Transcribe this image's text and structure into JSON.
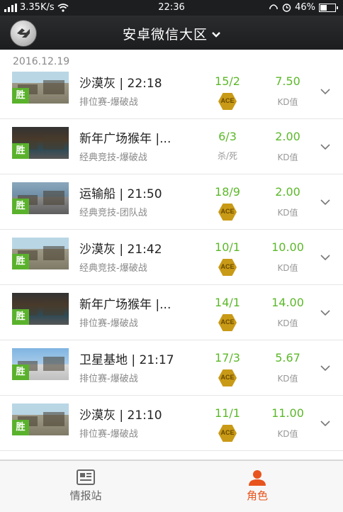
{
  "status_bar": {
    "signal": "ᵢₗ",
    "speed": "3.35K/s",
    "time": "22:36",
    "battery": "46%",
    "battery_level": 0.46
  },
  "header": {
    "title": "安卓微信大区"
  },
  "date": "2016.12.19",
  "matches": [
    {
      "map": "沙漠灰 | 22:18",
      "mode": "排位赛-爆破战",
      "score": "15/2",
      "badge": "ACE",
      "sub_text": "",
      "kd": "7.50",
      "kd_label": "KD值",
      "result": "胜",
      "thumb": "desert"
    },
    {
      "map": "新年广场猴年 |...",
      "mode": "经典竞技-爆破战",
      "score": "6/3",
      "badge": "",
      "sub_text": "杀/死",
      "kd": "2.00",
      "kd_label": "KD值",
      "result": "胜",
      "thumb": "night"
    },
    {
      "map": "运输船 | 21:50",
      "mode": "经典竞技-团队战",
      "score": "18/9",
      "badge": "ACE",
      "sub_text": "",
      "kd": "2.00",
      "kd_label": "KD值",
      "result": "胜",
      "thumb": "sea"
    },
    {
      "map": "沙漠灰 | 21:42",
      "mode": "经典竞技-爆破战",
      "score": "10/1",
      "badge": "ACE",
      "sub_text": "",
      "kd": "10.00",
      "kd_label": "KD值",
      "result": "胜",
      "thumb": "desert"
    },
    {
      "map": "新年广场猴年 |...",
      "mode": "排位赛-爆破战",
      "score": "14/1",
      "badge": "ACE",
      "sub_text": "",
      "kd": "14.00",
      "kd_label": "KD值",
      "result": "胜",
      "thumb": "night"
    },
    {
      "map": "卫星基地 | 21:17",
      "mode": "排位赛-爆破战",
      "score": "17/3",
      "badge": "ACE",
      "sub_text": "",
      "kd": "5.67",
      "kd_label": "KD值",
      "result": "胜",
      "thumb": "sat"
    },
    {
      "map": "沙漠灰 | 21:10",
      "mode": "排位赛-爆破战",
      "score": "11/1",
      "badge": "ACE",
      "sub_text": "",
      "kd": "11.00",
      "kd_label": "KD值",
      "result": "胜",
      "thumb": "desert"
    }
  ],
  "tabs": [
    {
      "label": "情报站",
      "icon": "news-icon",
      "active": false,
      "color": "#666666"
    },
    {
      "label": "角色",
      "icon": "person-icon",
      "active": true,
      "color": "#e8541e"
    }
  ],
  "colors": {
    "accent": "#e8541e",
    "green": "#5cb82a",
    "gold": "#c99a16"
  }
}
